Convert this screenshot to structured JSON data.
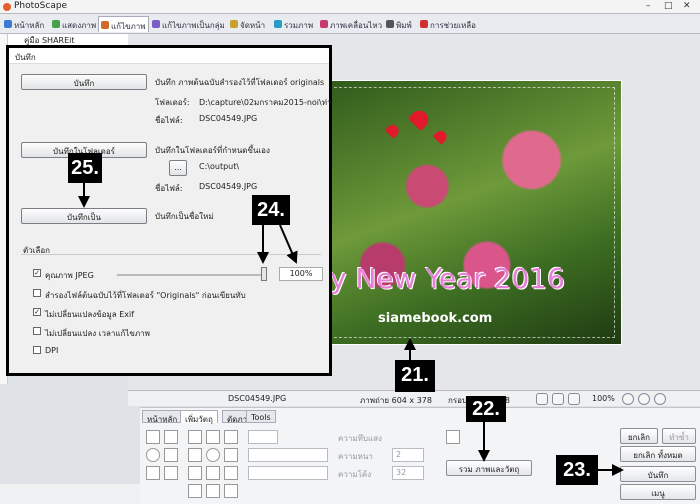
{
  "window": {
    "title": "PhotoScape",
    "controls": [
      "–",
      "□",
      "✕"
    ]
  },
  "tabs": [
    {
      "label": "หน้าหลัก",
      "color": "#3a7bd5"
    },
    {
      "label": "แสดงภาพ",
      "color": "#4aa04a"
    },
    {
      "label": "แก้ไขภาพ",
      "color": "#d06a2a",
      "active": true
    },
    {
      "label": "แก้ไขภาพเป็นกลุ่ม",
      "color": "#7a5ec8"
    },
    {
      "label": "จัดหน้า",
      "color": "#c8a02a"
    },
    {
      "label": "รวมภาพ",
      "color": "#2a9ac8"
    },
    {
      "label": "ภาพเคลื่อนไหว",
      "color": "#c83a6a"
    },
    {
      "label": "พิมพ์",
      "color": "#555555"
    },
    {
      "label": "การช่วยเหลือ",
      "color": "#d03030"
    }
  ],
  "explorer": {
    "folder": "คู่มือ SHAREit"
  },
  "photo": {
    "greeting": "y New Year 2016",
    "watermark": "siamebook.com"
  },
  "status": {
    "filename": "DSC04549.JPG",
    "photo_size": "ภาพถ่าย 604 x 378",
    "frame_size": "กรอบ 604 x 378",
    "zoom": "100%"
  },
  "bottom_panel": {
    "tabs": [
      "หน้าหลัก",
      "เพิ่มวัตถุ",
      "ตัดภาพ",
      "Tools"
    ],
    "active_tab": "เพิ่มวัตถุ",
    "transparency_label": "ความทึบแสง",
    "thickness_label": "ความหนา",
    "thickness_value": "2",
    "roundness_label": "ความโค้ง",
    "roundness_value": "32",
    "merge_button": "รวม ภาพและวัตถุ",
    "cancel_button": "ยกเลิก",
    "redo_button": "ทำซ้ำ",
    "cancel_all_button": "ยกเลิก ทั้งหมด",
    "save_button": "บันทึก",
    "menu_button": "เมนู"
  },
  "dialog": {
    "title": "บันทึก",
    "save_button": "บันทึก",
    "save_desc": "บันทึก ภาพต้นฉบับสำรองไว้ที่โฟลเดอร์ originals",
    "folder_label": "โฟลเดอร์:",
    "folder_value": "D:\\capture\\02มกราคม2015-noi\\ท่า",
    "file_label": "ชื่อไฟล์:",
    "file_value": "DSC04549.JPG",
    "save_to_folder_button": "บันทึกในโฟลเดอร์",
    "save_to_folder_desc": "บันทึกในโฟลเดอร์ที่กำหนดขึ้นเอง",
    "browse_button": "...",
    "output_folder": "C:\\output\\",
    "output_file_label": "ชื่อไฟล์:",
    "output_file": "DSC04549.JPG",
    "save_as_button": "บันทึกเป็น",
    "save_as_desc": "บันทึกเป็นชื่อใหม่",
    "options_label": "ตัวเลือก",
    "jpeg_quality_label": "คุณภาพ JPEG",
    "jpeg_quality_value": "100%",
    "options": [
      {
        "label": "คุณภาพ JPEG",
        "checked": true
      },
      {
        "label": "สำรองไฟล์ต้นฉบับไว้ที่โฟลเดอร์ \"Originals\" ก่อนเขียนทับ",
        "checked": false
      },
      {
        "label": "ไม่เปลี่ยนแปลงข้อมูล Exif",
        "checked": true
      },
      {
        "label": "ไม่เปลี่ยนแปลง เวลาแก้ไขภาพ",
        "checked": false
      },
      {
        "label": "DPI",
        "checked": false
      }
    ]
  },
  "annotations": {
    "a21": "21.",
    "a22": "22.",
    "a23": "23.",
    "a24": "24.",
    "a25": "25."
  }
}
